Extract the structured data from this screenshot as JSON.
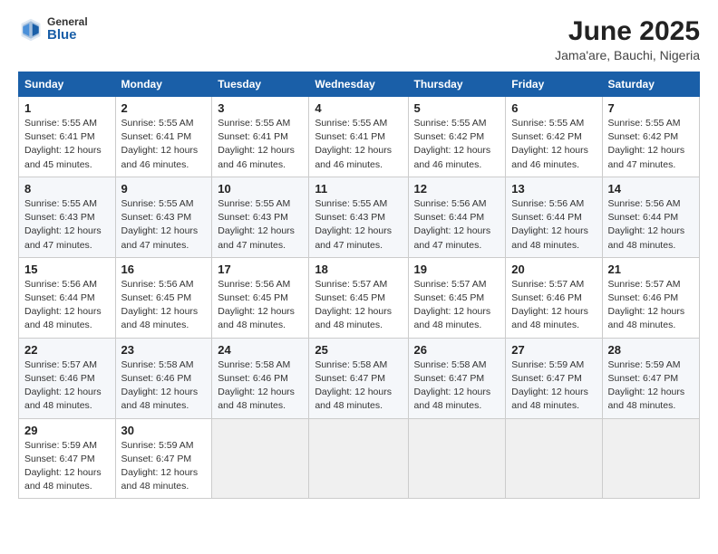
{
  "header": {
    "logo_general": "General",
    "logo_blue": "Blue",
    "title": "June 2025",
    "subtitle": "Jama'are, Bauchi, Nigeria"
  },
  "columns": [
    "Sunday",
    "Monday",
    "Tuesday",
    "Wednesday",
    "Thursday",
    "Friday",
    "Saturday"
  ],
  "weeks": [
    [
      {
        "day": "1",
        "info": "Sunrise: 5:55 AM\nSunset: 6:41 PM\nDaylight: 12 hours\nand 45 minutes."
      },
      {
        "day": "2",
        "info": "Sunrise: 5:55 AM\nSunset: 6:41 PM\nDaylight: 12 hours\nand 46 minutes."
      },
      {
        "day": "3",
        "info": "Sunrise: 5:55 AM\nSunset: 6:41 PM\nDaylight: 12 hours\nand 46 minutes."
      },
      {
        "day": "4",
        "info": "Sunrise: 5:55 AM\nSunset: 6:41 PM\nDaylight: 12 hours\nand 46 minutes."
      },
      {
        "day": "5",
        "info": "Sunrise: 5:55 AM\nSunset: 6:42 PM\nDaylight: 12 hours\nand 46 minutes."
      },
      {
        "day": "6",
        "info": "Sunrise: 5:55 AM\nSunset: 6:42 PM\nDaylight: 12 hours\nand 46 minutes."
      },
      {
        "day": "7",
        "info": "Sunrise: 5:55 AM\nSunset: 6:42 PM\nDaylight: 12 hours\nand 47 minutes."
      }
    ],
    [
      {
        "day": "8",
        "info": "Sunrise: 5:55 AM\nSunset: 6:43 PM\nDaylight: 12 hours\nand 47 minutes."
      },
      {
        "day": "9",
        "info": "Sunrise: 5:55 AM\nSunset: 6:43 PM\nDaylight: 12 hours\nand 47 minutes."
      },
      {
        "day": "10",
        "info": "Sunrise: 5:55 AM\nSunset: 6:43 PM\nDaylight: 12 hours\nand 47 minutes."
      },
      {
        "day": "11",
        "info": "Sunrise: 5:55 AM\nSunset: 6:43 PM\nDaylight: 12 hours\nand 47 minutes."
      },
      {
        "day": "12",
        "info": "Sunrise: 5:56 AM\nSunset: 6:44 PM\nDaylight: 12 hours\nand 47 minutes."
      },
      {
        "day": "13",
        "info": "Sunrise: 5:56 AM\nSunset: 6:44 PM\nDaylight: 12 hours\nand 48 minutes."
      },
      {
        "day": "14",
        "info": "Sunrise: 5:56 AM\nSunset: 6:44 PM\nDaylight: 12 hours\nand 48 minutes."
      }
    ],
    [
      {
        "day": "15",
        "info": "Sunrise: 5:56 AM\nSunset: 6:44 PM\nDaylight: 12 hours\nand 48 minutes."
      },
      {
        "day": "16",
        "info": "Sunrise: 5:56 AM\nSunset: 6:45 PM\nDaylight: 12 hours\nand 48 minutes."
      },
      {
        "day": "17",
        "info": "Sunrise: 5:56 AM\nSunset: 6:45 PM\nDaylight: 12 hours\nand 48 minutes."
      },
      {
        "day": "18",
        "info": "Sunrise: 5:57 AM\nSunset: 6:45 PM\nDaylight: 12 hours\nand 48 minutes."
      },
      {
        "day": "19",
        "info": "Sunrise: 5:57 AM\nSunset: 6:45 PM\nDaylight: 12 hours\nand 48 minutes."
      },
      {
        "day": "20",
        "info": "Sunrise: 5:57 AM\nSunset: 6:46 PM\nDaylight: 12 hours\nand 48 minutes."
      },
      {
        "day": "21",
        "info": "Sunrise: 5:57 AM\nSunset: 6:46 PM\nDaylight: 12 hours\nand 48 minutes."
      }
    ],
    [
      {
        "day": "22",
        "info": "Sunrise: 5:57 AM\nSunset: 6:46 PM\nDaylight: 12 hours\nand 48 minutes."
      },
      {
        "day": "23",
        "info": "Sunrise: 5:58 AM\nSunset: 6:46 PM\nDaylight: 12 hours\nand 48 minutes."
      },
      {
        "day": "24",
        "info": "Sunrise: 5:58 AM\nSunset: 6:46 PM\nDaylight: 12 hours\nand 48 minutes."
      },
      {
        "day": "25",
        "info": "Sunrise: 5:58 AM\nSunset: 6:47 PM\nDaylight: 12 hours\nand 48 minutes."
      },
      {
        "day": "26",
        "info": "Sunrise: 5:58 AM\nSunset: 6:47 PM\nDaylight: 12 hours\nand 48 minutes."
      },
      {
        "day": "27",
        "info": "Sunrise: 5:59 AM\nSunset: 6:47 PM\nDaylight: 12 hours\nand 48 minutes."
      },
      {
        "day": "28",
        "info": "Sunrise: 5:59 AM\nSunset: 6:47 PM\nDaylight: 12 hours\nand 48 minutes."
      }
    ],
    [
      {
        "day": "29",
        "info": "Sunrise: 5:59 AM\nSunset: 6:47 PM\nDaylight: 12 hours\nand 48 minutes."
      },
      {
        "day": "30",
        "info": "Sunrise: 5:59 AM\nSunset: 6:47 PM\nDaylight: 12 hours\nand 48 minutes."
      },
      {
        "day": "",
        "info": ""
      },
      {
        "day": "",
        "info": ""
      },
      {
        "day": "",
        "info": ""
      },
      {
        "day": "",
        "info": ""
      },
      {
        "day": "",
        "info": ""
      }
    ]
  ]
}
